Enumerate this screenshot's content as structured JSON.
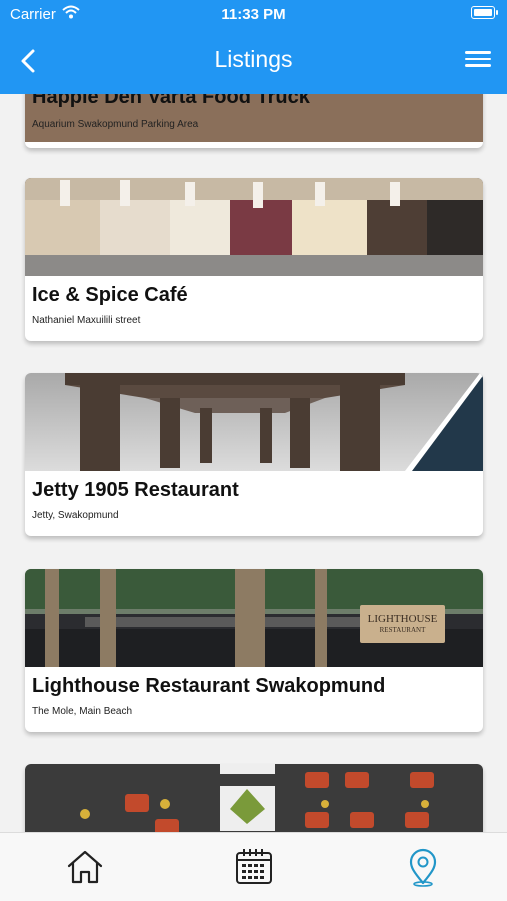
{
  "status_bar": {
    "carrier": "Carrier",
    "time": "11:33 PM"
  },
  "nav": {
    "title": "Listings"
  },
  "listings": [
    {
      "name": "Happie Den Varta Food Truck",
      "address": "Aquarium Swakopmund Parking Area"
    },
    {
      "name": "Ice & Spice Café",
      "address": "Nathaniel Maxuilili street"
    },
    {
      "name": "Jetty 1905 Restaurant",
      "address": "Jetty, Swakopmund"
    },
    {
      "name": "Lighthouse Restaurant Swakopmund",
      "address": "The Mole, Main Beach"
    }
  ],
  "lighthouse_sign": {
    "line1": "LIGHTHOUSE",
    "line2": "RESTAURANT"
  },
  "tabs": [
    {
      "icon": "home-icon"
    },
    {
      "icon": "calendar-icon"
    },
    {
      "icon": "map-pin-icon",
      "active": true
    }
  ],
  "colors": {
    "accent": "#2196f3",
    "active_tab": "#2196c8",
    "inactive_tab": "#222222"
  }
}
